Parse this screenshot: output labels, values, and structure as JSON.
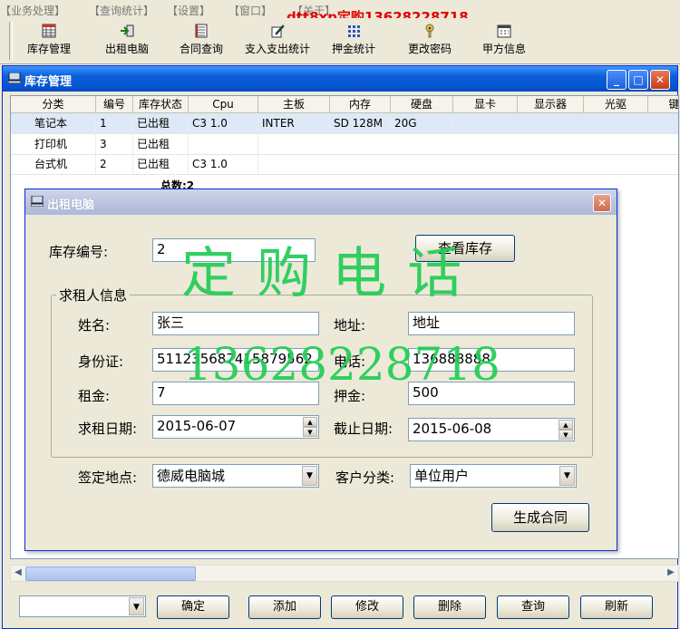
{
  "menubar": {
    "items": [
      "【业务处理】",
      "【查询统计】",
      "【设置】",
      "【窗口】",
      "【关于】"
    ],
    "watermark": "dtt8xp定购13628228718"
  },
  "toolbar": {
    "buttons": [
      {
        "label": "库存管理",
        "icon": "grid-icon"
      },
      {
        "label": "出租电脑",
        "icon": "arrow-icon"
      },
      {
        "label": "合同查询",
        "icon": "ledger-icon"
      },
      {
        "label": "支入支出统计",
        "icon": "pencil-icon"
      },
      {
        "label": "押金统计",
        "icon": "dots-icon"
      },
      {
        "label": "更改密码",
        "icon": "key-icon"
      },
      {
        "label": "甲方信息",
        "icon": "calendar-icon"
      }
    ]
  },
  "inventory_window": {
    "title": "库存管理",
    "columns": [
      "分类",
      "编号",
      "库存状态",
      "Cpu",
      "主板",
      "内存",
      "硬盘",
      "显卡",
      "显示器",
      "光驱",
      "键"
    ],
    "rows": [
      {
        "category": "笔记本",
        "id": "1",
        "status": "已出租",
        "cpu": "C3 1.0",
        "board": "INTER",
        "memory": "SD 128M",
        "disk": "20G"
      },
      {
        "category": "打印机",
        "id": "3",
        "status": "已出租",
        "cpu": "",
        "board": "",
        "memory": "",
        "disk": ""
      },
      {
        "category": "台式机",
        "id": "2",
        "status": "已出租",
        "cpu": "C3 1.0",
        "board": "",
        "memory": "",
        "disk": ""
      }
    ],
    "total_label": "总数:2"
  },
  "bottombar": {
    "combo_value": "",
    "buttons": [
      "确定",
      "添加",
      "修改",
      "删除",
      "查询",
      "刷新"
    ]
  },
  "dialog": {
    "title": "出租电脑",
    "stock_id_label": "库存编号:",
    "stock_id_value": "2",
    "view_stock_button": "查看库存",
    "group_title": "求租人信息",
    "name_label": "姓名:",
    "name_value": "张三",
    "address_label": "地址:",
    "address_value": "地址",
    "id_card_label": "身份证:",
    "id_card_value": "511235687415879562",
    "phone_label": "电话:",
    "phone_value": "136888888",
    "rent_label": "租金:",
    "rent_value": "7",
    "deposit_label": "押金:",
    "deposit_value": "500",
    "start_date_label": "求租日期:",
    "start_date_value": "2015-06-07",
    "end_date_label": "截止日期:",
    "end_date_value": "2015-06-08",
    "sign_place_label": "签定地点:",
    "sign_place_value": "德威电脑城",
    "customer_type_label": "客户分类:",
    "customer_type_value": "单位用户",
    "generate_button": "生成合同"
  },
  "watermarks": {
    "order_phone": "定  购  电  话",
    "phone_number": "13628228718"
  }
}
